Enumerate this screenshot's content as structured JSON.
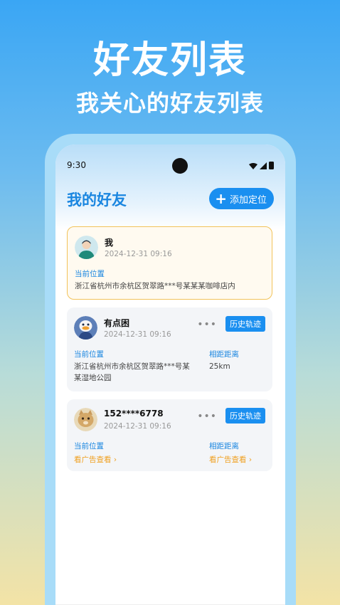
{
  "promo": {
    "title": "好友列表",
    "subtitle": "我关心的好友列表"
  },
  "status_bar": {
    "time": "9:30"
  },
  "header": {
    "title": "我的好友",
    "add_button_icon": "plus-icon",
    "add_button_label": "添加定位"
  },
  "friends": [
    {
      "name": "我",
      "time": "2024-12-31  09:16",
      "location_label": "当前位置",
      "location": "浙江省杭州市余杭区贺翠路***号某某某咖啡店内"
    },
    {
      "name": "有点困",
      "time": "2024-12-31  09:16",
      "more": "•••",
      "history_label": "历史轨迹",
      "location_label": "当前位置",
      "location": "浙江省杭州市余杭区贺翠路***号某某湿地公园",
      "distance_label": "相距距离",
      "distance": "25km"
    },
    {
      "name": "152****6778",
      "time": "2024-12-31  09:16",
      "more": "•••",
      "history_label": "历史轨迹",
      "location_label": "当前位置",
      "location_link": "看广告查看 ›",
      "distance_label": "相距距离",
      "distance_link": "看广告查看 ›"
    }
  ],
  "colors": {
    "accent": "#1a8ff0",
    "title_blue": "#1a86e0",
    "ad_orange": "#f0a020",
    "me_border": "#f2c35a"
  }
}
